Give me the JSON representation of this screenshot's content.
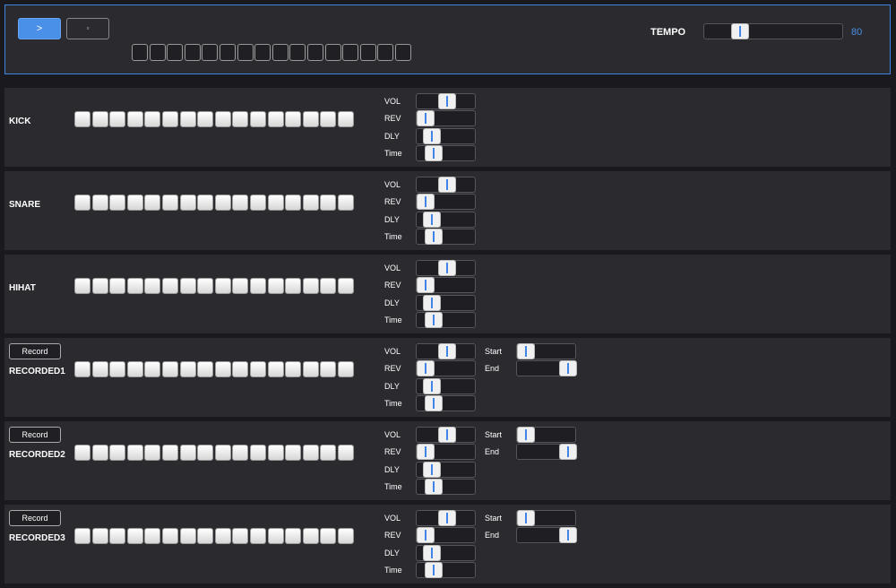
{
  "header": {
    "play_label": ">",
    "stop_label": "▫",
    "step_count": 16,
    "tempo_label": "TEMPO",
    "tempo_value": "80",
    "tempo_level": 0.22
  },
  "param_labels": {
    "vol": "VOL",
    "rev": "REV",
    "dly": "DLY",
    "time": "Time",
    "start": "Start",
    "end": "End"
  },
  "record_label": "Record",
  "tracks": [
    {
      "name": "KICK",
      "recorded": false,
      "params": {
        "vol": 0.5,
        "rev": 0.0,
        "dly": 0.15,
        "time": 0.2
      }
    },
    {
      "name": "SNARE",
      "recorded": false,
      "params": {
        "vol": 0.5,
        "rev": 0.0,
        "dly": 0.15,
        "time": 0.2
      }
    },
    {
      "name": "HIHAT",
      "recorded": false,
      "params": {
        "vol": 0.5,
        "rev": 0.0,
        "dly": 0.15,
        "time": 0.2
      }
    },
    {
      "name": "RECORDED1",
      "recorded": true,
      "params": {
        "vol": 0.5,
        "rev": 0.0,
        "dly": 0.15,
        "time": 0.2,
        "start": 0.0,
        "end": 1.0
      }
    },
    {
      "name": "RECORDED2",
      "recorded": true,
      "params": {
        "vol": 0.5,
        "rev": 0.0,
        "dly": 0.15,
        "time": 0.2,
        "start": 0.0,
        "end": 1.0
      }
    },
    {
      "name": "RECORDED3",
      "recorded": true,
      "params": {
        "vol": 0.5,
        "rev": 0.0,
        "dly": 0.15,
        "time": 0.2,
        "start": 0.0,
        "end": 1.0
      }
    }
  ],
  "colors": {
    "accent": "#4a90e8",
    "panel": "#2a2a2f",
    "background": "#1a1a1e"
  }
}
